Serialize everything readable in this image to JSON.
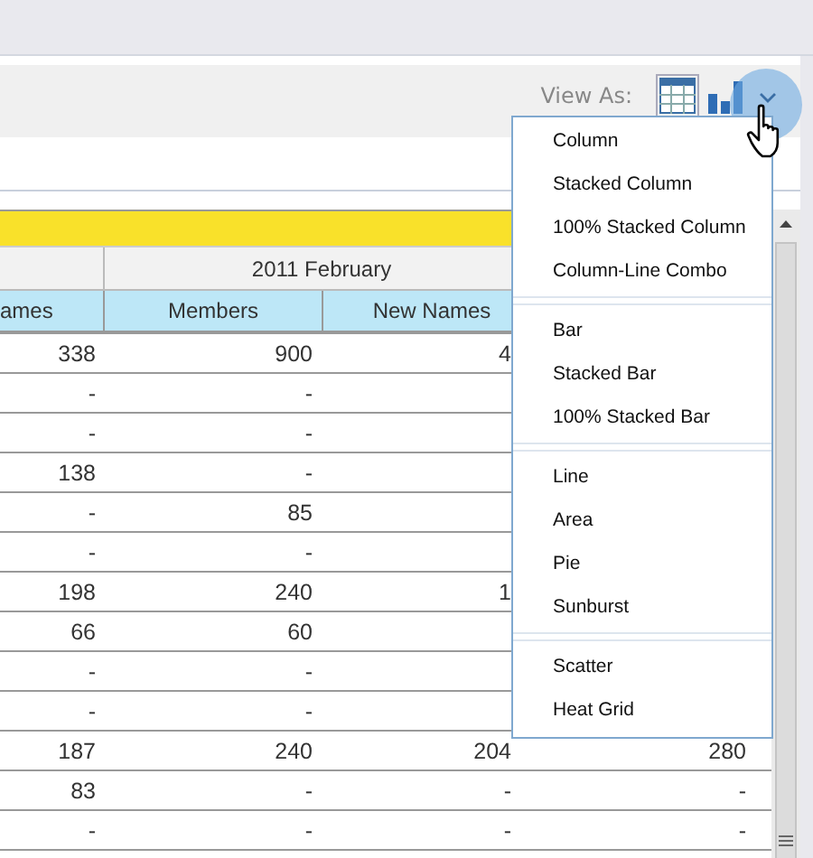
{
  "toolbar": {
    "view_as_label": "View As:",
    "views": [
      {
        "kind": "table",
        "selected": true
      },
      {
        "kind": "chart",
        "selected": false
      }
    ]
  },
  "table": {
    "group_header": "2011 February",
    "columns": [
      "ames",
      "Members",
      "New Names"
    ],
    "rows": [
      {
        "cells": [
          "338",
          "900",
          "4"
        ]
      },
      {
        "cells": [
          "-",
          "-"
        ]
      },
      {
        "cells": [
          "-",
          "-"
        ]
      },
      {
        "cells": [
          "138",
          "-"
        ]
      },
      {
        "cells": [
          "-",
          "85"
        ]
      },
      {
        "cells": [
          "-",
          "-"
        ]
      },
      {
        "cells": [
          "198",
          "240",
          "1"
        ]
      },
      {
        "cells": [
          "66",
          "60"
        ]
      },
      {
        "cells": [
          "-",
          "-"
        ]
      },
      {
        "cells": [
          "-",
          "-"
        ]
      },
      {
        "cells": [
          "187",
          "240",
          "204",
          "280"
        ]
      },
      {
        "cells": [
          "83",
          "-",
          "-",
          "-"
        ]
      },
      {
        "cells": [
          "-",
          "-",
          "-",
          "-"
        ]
      }
    ]
  },
  "chart_menu": {
    "groups": [
      [
        "Column",
        "Stacked Column",
        "100% Stacked Column",
        "Column-Line Combo"
      ],
      [
        "Bar",
        "Stacked Bar",
        "100% Stacked Bar"
      ],
      [
        "Line",
        "Area",
        "Pie",
        "Sunburst"
      ],
      [
        "Scatter",
        "Heat Grid"
      ]
    ]
  }
}
